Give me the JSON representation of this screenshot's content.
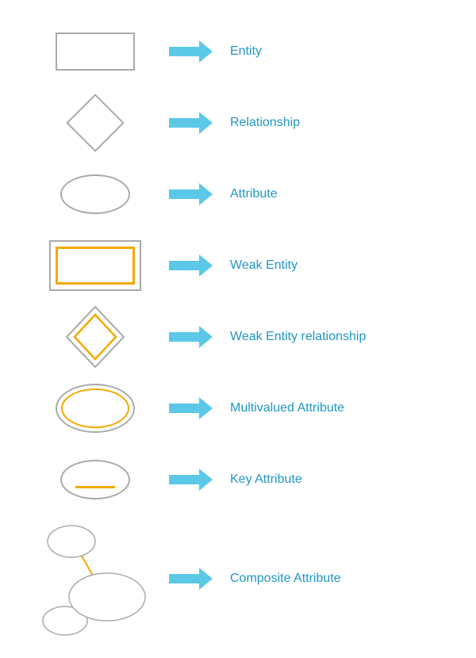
{
  "items": [
    {
      "id": "entity",
      "label": "Entity"
    },
    {
      "id": "relationship",
      "label": "Relationship"
    },
    {
      "id": "attribute",
      "label": "Attribute"
    },
    {
      "id": "weak-entity",
      "label": "Weak Entity"
    },
    {
      "id": "weak-entity-relationship",
      "label": "Weak Entity relationship"
    },
    {
      "id": "multivalued-attribute",
      "label": "Multivalued Attribute"
    },
    {
      "id": "key-attribute",
      "label": "Key Attribute"
    },
    {
      "id": "composite-attribute",
      "label": "Composite Attribute"
    }
  ],
  "arrow_color": "#5bc8e8"
}
